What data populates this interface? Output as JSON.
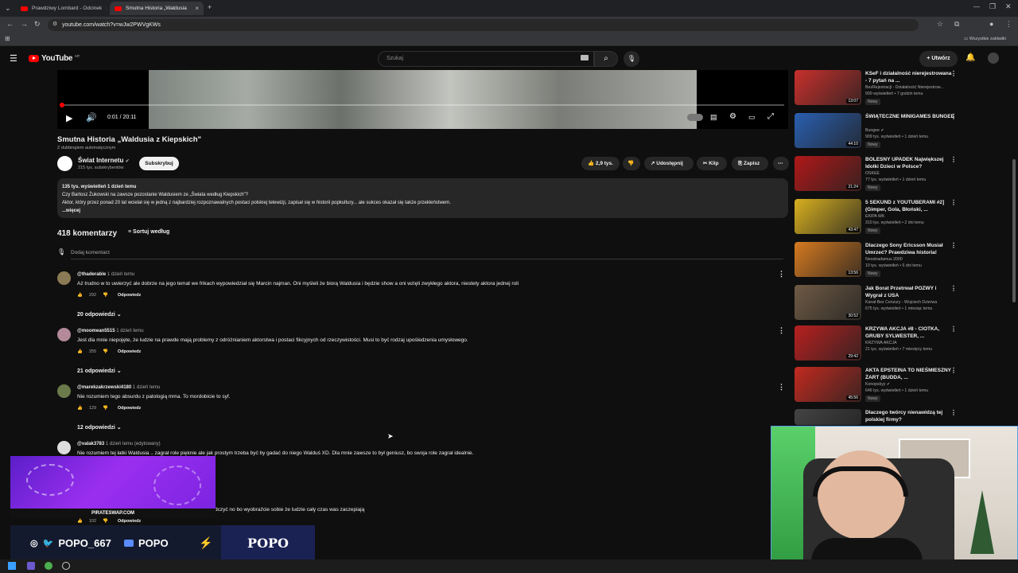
{
  "browser": {
    "tabs": [
      {
        "label": "Prawdziwy Lombard - Odcinek"
      },
      {
        "label": "Smutna Historia „Waldusia"
      }
    ],
    "url": "youtube.com/watch?v=wJw2PWVgKWs",
    "bookmarks_label": "Wszystkie zakładki"
  },
  "header": {
    "logo": "YouTube",
    "logo_country": "MT",
    "search_placeholder": "Szukaj",
    "create_label": "Utwórz"
  },
  "player": {
    "time": "0:01 / 20:11",
    "progress_fraction": 0.001
  },
  "video": {
    "title": "Smutna Historia „Waldusia z Kiepskich\"",
    "dub_note": "Z dubbingiem automatycznym",
    "channel": "Świat Internetu",
    "subscribers": "215 tys. subskrybentów",
    "subscribe_label": "Subskrybuj",
    "likes": "2,9 tys.",
    "share_label": "Udostępnij",
    "clip_label": "Klip",
    "save_label": "Zapisz"
  },
  "description": {
    "stats": "135 tys. wyświetleń  1 dzień temu",
    "line1": "Czy Bartosz Żukowski na zawsze pozostanie Waldusiem ze „Świata według Kiepskich\"?",
    "line2": "Aktor, który przez ponad 20 lat wcielał się w jedną z najbardziej rozpoznawalnych postaci polskiej telewizji, zapisał się w historii popkultury... ale sukces okazał się także przekleństwem.",
    "more": "...więcej"
  },
  "comments": {
    "count": "418 komentarzy",
    "sort_label": "Sortuj według",
    "add_placeholder": "Dodaj komentarz",
    "reply_label": "Odpowiedz",
    "items": [
      {
        "author": "@thaderable",
        "time": "1 dzień temu",
        "text": "Aż trudno w to uwierzyć ale dobrze na jego temat we frikach wypowiedział się Marcin najman. Oni myśleli że biorą Waldusia i będzie show a oni wzięli zwykłego aktora, niestety aktora jednej roli",
        "likes": "292",
        "replies": "20 odpowiedzi"
      },
      {
        "author": "@moomean5515",
        "time": "1 dzień temu",
        "text": "Jest dla mnie niepojęte, że ludzie na prawde mają problemy z odróżnianiem aktorstwa i postaci fikcyjnych od rzeczywistości. Musi to być rodzaj upośledzenia umysłowego.",
        "likes": "255",
        "replies": "21 odpowiedzi"
      },
      {
        "author": "@marekzakrzewski4180",
        "time": "1 dzień temu",
        "text": "Nie rozumiem tego absurdu z patologią mma. To mordobicie to syf.",
        "likes": "129",
        "replies": "12 odpowiedzi"
      },
      {
        "author": "@valak3783",
        "time": "1 dzień temu (edytowany)",
        "text": "Nie rozumiem tej łatki Waldusia .. zagrał role pięknie ale jak prostym trzeba być by gadać do niego Walduś XD. Dla mnie zawsze to był geniusz, bo swoja role zagrał idealnie."
      },
      {
        "text": "dczyć no bo wyobraźcie sobie że ludzie cały czas was zaczepiają",
        "likes": "102"
      }
    ]
  },
  "sidebar": [
    {
      "title": "KSeF i działalność nierejestrowana - 7 pytań na ...",
      "channel": "BezRejestracji - Działalność Nierejestrow...",
      "meta": "900 wyświetleń • 7 godzin temu",
      "badge": "Nowy",
      "duration": "13:07",
      "color": "#c8302c"
    },
    {
      "title": "ŚWIĄTECZNE MINIGAMES BUNGEE",
      "channel": "Bungee ✔",
      "meta": "909 tys. wyświetleń • 1 dzień temu",
      "badge": "Nowy",
      "duration": "44:10",
      "color": "#2a5fb0"
    },
    {
      "title": "BOLESNY UPADEK Największej Idolki Dzieci w Polsce?",
      "channel": "OSKEE",
      "meta": "77 tys. wyświetleń • 1 dzień temu",
      "badge": "Nowy",
      "duration": "21:24",
      "color": "#b01818"
    },
    {
      "title": "5 SEKUND z YOUTUBERAMI #2] (Gimper, Gola, Błoński, ...",
      "channel": "EKIPA WK",
      "meta": "310 tys. wyświetleń • 2 dni temu",
      "badge": "Nowy",
      "duration": "43:47",
      "color": "#d8b020"
    },
    {
      "title": "Dlaczego Sony Ericsson Musiał Umrzeć? Prawdziwa historia!",
      "channel": "Neostradamus 2000",
      "meta": "10 tys. wyświetleń • 6 dni temu",
      "badge": "Nowy",
      "duration": "13:56",
      "color": "#d67a20"
    },
    {
      "title": "Jak Borat Przetrwał POZWY i Wygrał z USA",
      "channel": "Kanał Bez Cenzury - Wojciech Dzierwa",
      "meta": "675 tys. wyświetleń • 1 miesiąc temu",
      "badge": "",
      "duration": "30:52",
      "color": "#6f5a44"
    },
    {
      "title": "KRZYWA AKCJA #8 - CIOTKA, GRUBY SYLWESTER, ...",
      "channel": "KRZYWA AKCJA",
      "meta": "21 tys. wyświetleń • 7 miesięcy temu",
      "badge": "",
      "duration": "29:42",
      "color": "#b82020"
    },
    {
      "title": "AKTA EPSTEINA TO NIEŚMIESZNY ŻART (BUDDA, ...",
      "channel": "Konopskyy ✔",
      "meta": "646 tys. wyświetleń • 1 dzień temu",
      "badge": "Nowy",
      "duration": "45:56",
      "color": "#c22a20"
    },
    {
      "title": "Dlaczego twórcy nienawidzą tej polskiej firmy?",
      "channel": "",
      "meta": "",
      "badge": "",
      "duration": "",
      "color": "#444"
    }
  ],
  "overlay": {
    "promo_label": "PIRATESWAP.COM",
    "social_handle": "POPO_667",
    "yt_name": "POPO",
    "brand": "POPO"
  }
}
